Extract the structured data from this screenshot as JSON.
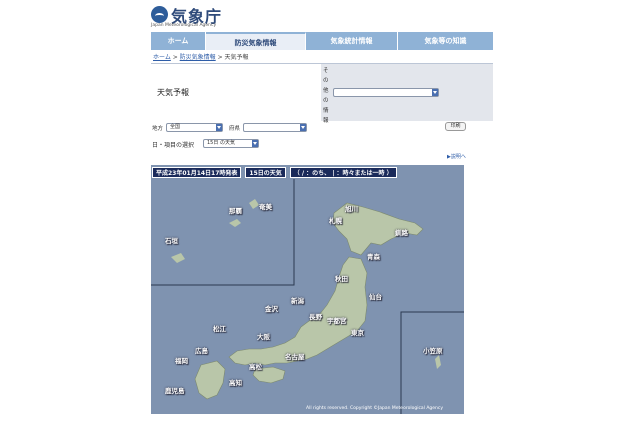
{
  "header": {
    "logo_jp": "気象庁",
    "logo_en": "Japan Meteorological Agency"
  },
  "nav": {
    "tabs": [
      {
        "label": "ホーム"
      },
      {
        "label": "防災気象情報"
      },
      {
        "label": "気象統計情報"
      },
      {
        "label": "気象等の知識"
      }
    ]
  },
  "breadcrumb": {
    "home": "ホーム",
    "sep1": " > ",
    "disaster": "防災気象情報",
    "sep2": " > ",
    "current": "天気予報"
  },
  "panel": {
    "title": "天気予報",
    "other_label": "その他の情報"
  },
  "filters": {
    "region_label": "地方",
    "region_value": "全国",
    "pref_label": "府県",
    "pref_value": "",
    "print_label": "印刷",
    "day_item_label": "日・項目の選択",
    "day_item_value": "15日 の天気",
    "help_label": "▶説明へ"
  },
  "map": {
    "issued": "平成23年01月14日17時発表",
    "day": "15日の天気",
    "legend": "（ / ：のち、 | ：時々または一時 ）",
    "copyright": "All rights reserved. Copyright ©Japan Meteorological Agency",
    "colors": {
      "sea": "#7f93b0",
      "land": "#b9c6a9",
      "banner": "#1a2a5a"
    },
    "cities": [
      {
        "name": "那覇"
      },
      {
        "name": "奄美"
      },
      {
        "name": "石垣"
      },
      {
        "name": "旭川"
      },
      {
        "name": "札幌"
      },
      {
        "name": "釧路"
      },
      {
        "name": "青森"
      },
      {
        "name": "秋田"
      },
      {
        "name": "仙台"
      },
      {
        "name": "新潟"
      },
      {
        "name": "金沢"
      },
      {
        "name": "長野"
      },
      {
        "name": "宇都宮"
      },
      {
        "name": "東京"
      },
      {
        "name": "松江"
      },
      {
        "name": "大阪"
      },
      {
        "name": "広島"
      },
      {
        "name": "名古屋"
      },
      {
        "name": "福岡"
      },
      {
        "name": "高松"
      },
      {
        "name": "高知"
      },
      {
        "name": "鹿児島"
      },
      {
        "name": "小笠原"
      }
    ]
  }
}
